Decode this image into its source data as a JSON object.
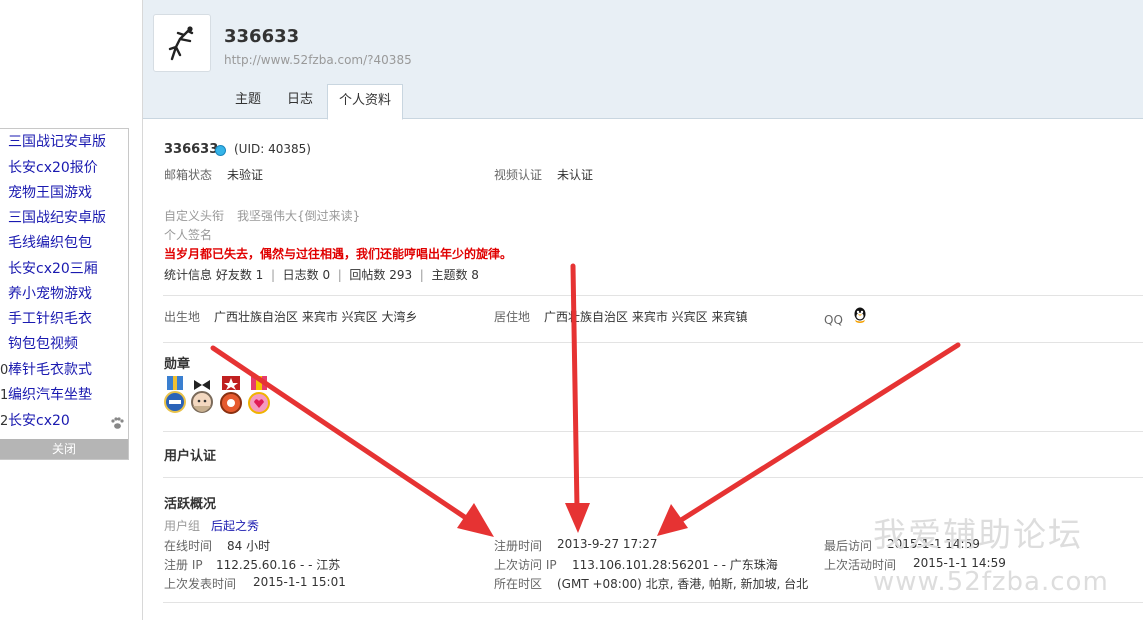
{
  "left_list": {
    "items": [
      {
        "num": "",
        "label": "三国战记安卓版"
      },
      {
        "num": "",
        "label": "长安cx20报价"
      },
      {
        "num": "",
        "label": "宠物王国游戏"
      },
      {
        "num": "",
        "label": "三国战纪安卓版"
      },
      {
        "num": "",
        "label": "毛线编织包包"
      },
      {
        "num": "",
        "label": "长安cx20三厢"
      },
      {
        "num": "",
        "label": "养小宠物游戏"
      },
      {
        "num": "",
        "label": "手工针织毛衣"
      },
      {
        "num": "",
        "label": "钩包包视频"
      },
      {
        "num": "0",
        "label": "棒针毛衣款式"
      },
      {
        "num": "1",
        "label": "编织汽车坐垫"
      },
      {
        "num": "2",
        "label": "长安cx20"
      }
    ],
    "close_label": "关闭"
  },
  "header": {
    "username": "336633",
    "url": "http://www.52fzba.com/?40385",
    "tabs": [
      "主题",
      "日志",
      "个人资料"
    ]
  },
  "profile": {
    "name": "336633",
    "uid": "(UID: 40385)",
    "email_label": "邮箱状态",
    "email_value": "未验证",
    "video_label": "视频认证",
    "video_value": "未认证",
    "custom_title_label": "自定义头衔",
    "custom_title_value": "我坚强伟大{倒过来读}",
    "signature_label": "个人签名",
    "signature_value": "当岁月都已失去，偶然与过往相遇，我们还能哼唱出年少的旋律。",
    "stats_label": "统计信息",
    "stats": [
      "好友数 1",
      "日志数 0",
      "回帖数 293",
      "主题数 8"
    ],
    "birthplace_label": "出生地",
    "birthplace_value": "广西壮族自治区 来宾市 兴宾区 大湾乡",
    "residence_label": "居住地",
    "residence_value": "广西壮族自治区 来宾市 兴宾区 来宾镇",
    "qq_label": "QQ"
  },
  "sections": {
    "medals": "勋章",
    "user_auth": "用户认证",
    "activity": "活跃概况"
  },
  "activity": {
    "usergroup_label": "用户组",
    "usergroup_value": "后起之秀",
    "online_label": "在线时间",
    "online_value": "84 小时",
    "reg_ip_label": "注册 IP",
    "reg_ip_value": "112.25.60.16 - - 江苏",
    "last_post_label": "上次发表时间",
    "last_post_value": "2015-1-1 15:01",
    "reg_time_label": "注册时间",
    "reg_time_value": "2013-9-27 17:27",
    "last_ip_label": "上次访问 IP",
    "last_ip_value": "113.106.101.28:56201 - - 广东珠海",
    "timezone_label": "所在时区",
    "timezone_value": "(GMT +08:00) 北京, 香港, 帕斯, 新加坡, 台北",
    "last_visit_label": "最后访问",
    "last_visit_value": "2015-1-1 14:59",
    "last_active_label": "上次活动时间",
    "last_active_value": "2015-1-1 14:59"
  },
  "watermark": {
    "line1": "我爱辅助论坛",
    "line2": "www.52fzba.com"
  },
  "colors": {
    "link": "#1a1ab0",
    "signature": "#e00000",
    "arrow": "#e63333",
    "header_bg": "#e8eff5"
  }
}
